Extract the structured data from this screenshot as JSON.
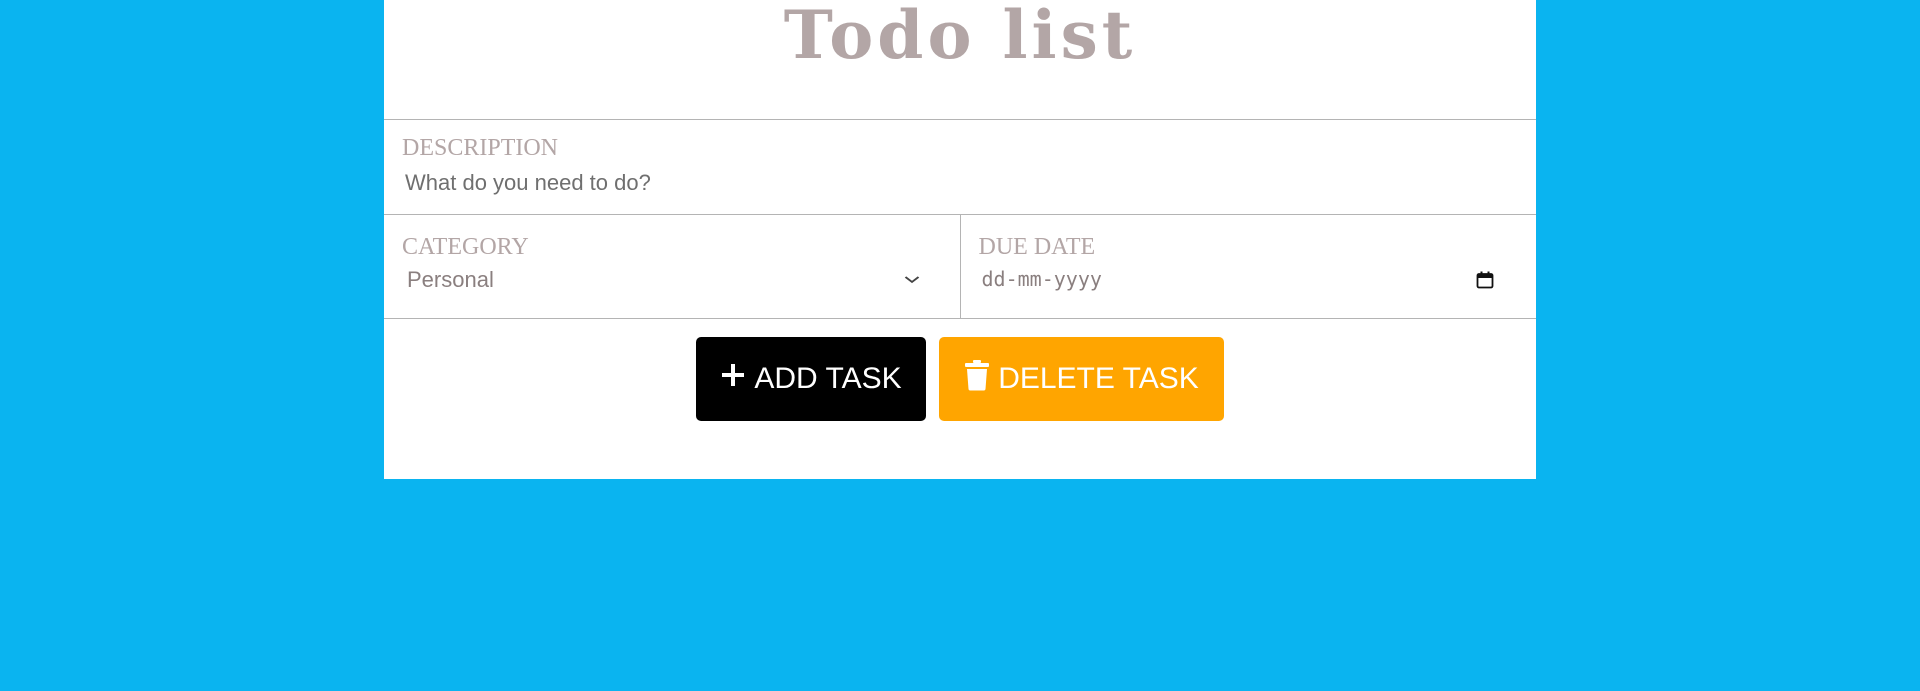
{
  "app": {
    "title": "Todo list"
  },
  "description": {
    "label": "DESCRIPTION",
    "placeholder": "What do you need to do?"
  },
  "category": {
    "label": "CATEGORY",
    "selected": "Personal"
  },
  "due_date": {
    "label": "DUE DATE",
    "placeholder": "dd-mm-yyyy"
  },
  "buttons": {
    "add_label": "ADD TASK",
    "delete_label": "DELETE TASK"
  },
  "colors": {
    "background": "#0ab4f0",
    "card": "#ffffff",
    "label": "#b3a6a6",
    "add_button": "#000000",
    "delete_button": "#ffa500"
  },
  "icons": {
    "add": "plus-icon",
    "delete": "trash-icon",
    "select": "chevron-down-icon",
    "date": "calendar-icon"
  }
}
